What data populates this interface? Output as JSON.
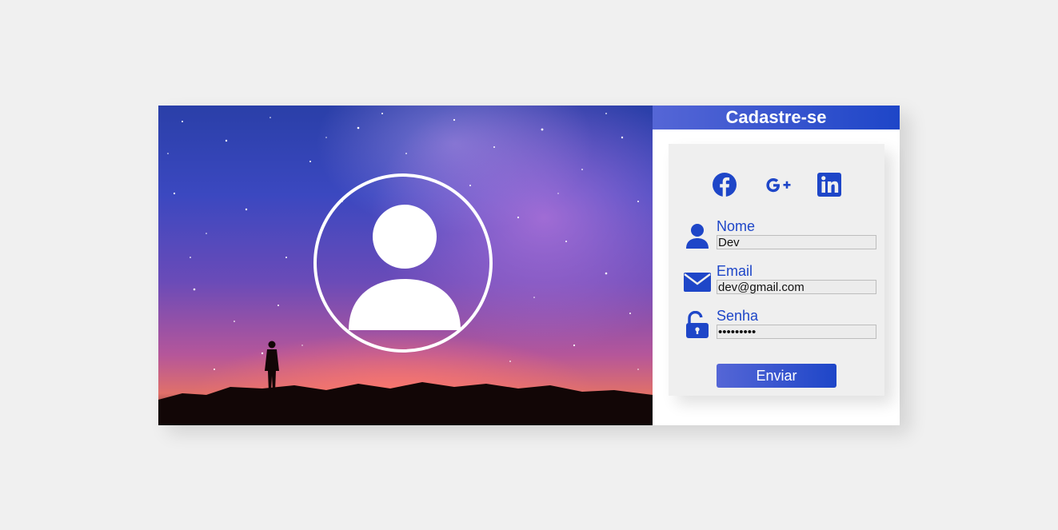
{
  "header": {
    "title": "Cadastre-se"
  },
  "socials": [
    {
      "icon": "facebook-icon"
    },
    {
      "icon": "google-plus-icon"
    },
    {
      "icon": "linkedin-icon"
    }
  ],
  "form": {
    "nome": {
      "label": "Nome",
      "value": "Dev",
      "icon": "user-icon"
    },
    "email": {
      "label": "Email",
      "value": "dev@gmail.com",
      "icon": "envelope-icon"
    },
    "senha": {
      "label": "Senha",
      "value": "•••••••••",
      "icon": "unlock-icon"
    },
    "submit_label": "Enviar"
  },
  "colors": {
    "accent": "#1e46c8",
    "accent_light": "#5566d6",
    "page_bg": "#f0f0f0",
    "form_bg": "#efefef"
  }
}
